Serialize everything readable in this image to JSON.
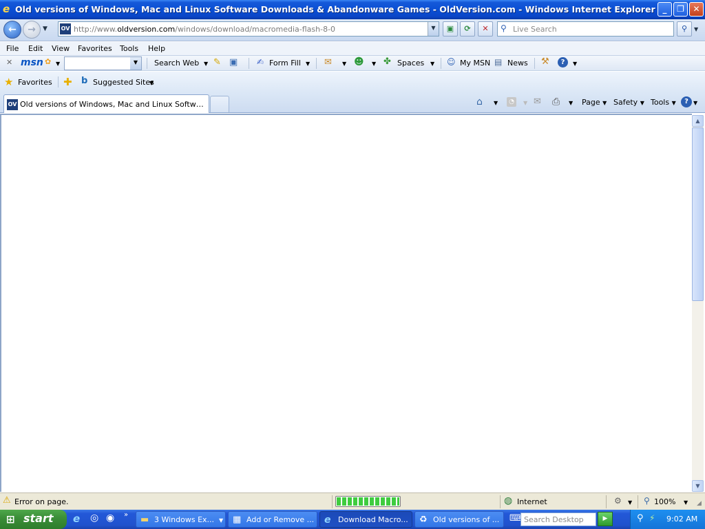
{
  "window": {
    "title": "Old versions of Windows, Mac and Linux Software Downloads & Abandonware Games - OldVersion.com - Windows Internet Explorer"
  },
  "address": {
    "favicon_text": "OV",
    "url_prefix": "http://www.",
    "url_domain": "oldversion.com",
    "url_path": "/windows/download/macromedia-flash-8-0"
  },
  "search": {
    "placeholder": "Live Search"
  },
  "menu": {
    "items": [
      "File",
      "Edit",
      "View",
      "Favorites",
      "Tools",
      "Help"
    ]
  },
  "msn_toolbar": {
    "logo": "msn",
    "search_web": "Search Web",
    "form_fill": "Form Fill",
    "spaces": "Spaces",
    "my_msn": "My MSN",
    "news": "News"
  },
  "favorites_bar": {
    "favorites": "Favorites",
    "suggested_sites": "Suggested Sites"
  },
  "tabs": [
    {
      "label": "Old versions of Windows, Mac and Linux Software Do...",
      "favicon_text": "OV"
    }
  ],
  "command_bar": {
    "page": "Page",
    "safety": "Safety",
    "tools": "Tools"
  },
  "status": {
    "message": "Error on page.",
    "zone": "Internet",
    "zoom": "100%",
    "progress": 1.0
  },
  "taskbar": {
    "start": "start",
    "tasks": [
      {
        "label": "3 Windows Ex...",
        "active": false
      },
      {
        "label": "Add or Remove ...",
        "active": false
      },
      {
        "label": "Download Macro...",
        "active": true
      },
      {
        "label": "Old versions of ...",
        "active": false
      }
    ],
    "desktop_search_placeholder": "Search Desktop",
    "clock": "9:02 AM"
  },
  "colors": {
    "title_bar": "#0a4fd4",
    "taskbar": "#2052cd",
    "start_button": "#3c8f39",
    "progress": "#3fcc3f"
  }
}
